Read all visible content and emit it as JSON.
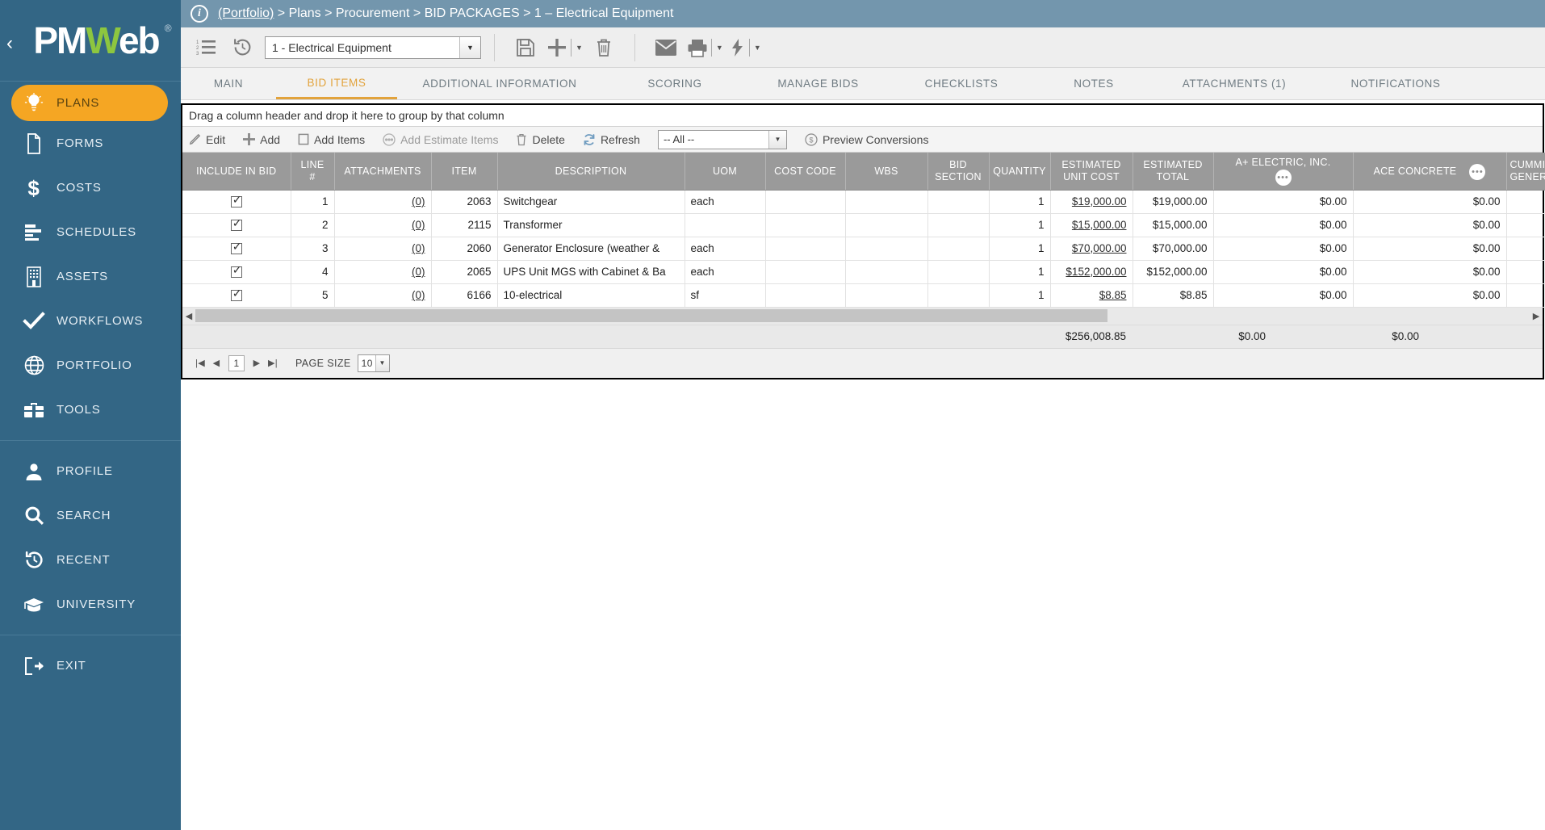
{
  "sidebar": {
    "logo": {
      "text_pm": "PM",
      "text_w": "W",
      "text_eb": "eb",
      "registered": "®",
      "collapse_icon": "‹"
    },
    "items": [
      {
        "label": "PLANS",
        "icon": "lightbulb-icon",
        "active": true
      },
      {
        "label": "FORMS",
        "icon": "document-icon",
        "active": false
      },
      {
        "label": "COSTS",
        "icon": "dollar-icon",
        "active": false
      },
      {
        "label": "SCHEDULES",
        "icon": "bars-icon",
        "active": false
      },
      {
        "label": "ASSETS",
        "icon": "building-icon",
        "active": false
      },
      {
        "label": "WORKFLOWS",
        "icon": "checkmark-icon",
        "active": false
      },
      {
        "label": "PORTFOLIO",
        "icon": "globe-icon",
        "active": false
      },
      {
        "label": "TOOLS",
        "icon": "toolbox-icon",
        "active": false
      }
    ],
    "items2": [
      {
        "label": "PROFILE",
        "icon": "person-icon"
      },
      {
        "label": "SEARCH",
        "icon": "search-icon"
      },
      {
        "label": "RECENT",
        "icon": "history-icon"
      },
      {
        "label": "UNIVERSITY",
        "icon": "graduation-cap-icon"
      }
    ],
    "items3": [
      {
        "label": "EXIT",
        "icon": "exit-icon"
      }
    ]
  },
  "breadcrumb": {
    "info_glyph": "i",
    "parts": [
      "(Portfolio)",
      "Plans",
      "Procurement",
      "BID PACKAGES",
      "1 – Electrical Equipment"
    ],
    "separator": ">"
  },
  "toolbar": {
    "list_icon": "numbered-list-icon",
    "history_icon": "history-icon",
    "record_select_value": "1 -  Electrical Equipment",
    "save_icon": "save-icon",
    "add_icon": "add-icon",
    "delete_icon": "trash-icon",
    "email_icon": "envelope-icon",
    "print_icon": "printer-icon",
    "actions_icon": "lightning-icon",
    "caret": "▼"
  },
  "tabs": [
    {
      "label": "MAIN",
      "active": false
    },
    {
      "label": "BID ITEMS",
      "active": true
    },
    {
      "label": "ADDITIONAL INFORMATION",
      "active": false
    },
    {
      "label": "SCORING",
      "active": false
    },
    {
      "label": "MANAGE BIDS",
      "active": false
    },
    {
      "label": "CHECKLISTS",
      "active": false
    },
    {
      "label": "NOTES",
      "active": false
    },
    {
      "label": "ATTACHMENTS (1)",
      "active": false
    },
    {
      "label": "NOTIFICATIONS",
      "active": false
    }
  ],
  "grid": {
    "group_hint": "Drag a column header and drop it here to group by that column",
    "toolbar": {
      "edit": "Edit",
      "add": "Add",
      "add_items": "Add Items",
      "add_estimate_items": "Add Estimate Items",
      "delete": "Delete",
      "refresh": "Refresh",
      "filter_value": "-- All --",
      "preview_conversions": "Preview Conversions",
      "preview_badge": "$"
    },
    "columns": [
      "INCLUDE IN BID",
      "LINE\n#",
      "ATTACHMENTS",
      "ITEM",
      "DESCRIPTION",
      "UOM",
      "COST CODE",
      "WBS",
      "BID\nSECTION",
      "QUANTITY",
      "ESTIMATED\nUNIT COST",
      "ESTIMATED\nTOTAL",
      "A+ ELECTRIC, INC.",
      "ACE CONCRETE",
      "CUMMINS\nGENERAT"
    ],
    "rows": [
      {
        "include": true,
        "line": "1",
        "attachments": "(0)",
        "item": "2063",
        "description": "Switchgear",
        "uom": "each",
        "cost_code": "",
        "wbs": "",
        "bid_section": "",
        "quantity": "1",
        "est_unit_cost": "$19,000.00",
        "est_total": "$19,000.00",
        "vendor1": "$0.00",
        "vendor2": "$0.00"
      },
      {
        "include": true,
        "line": "2",
        "attachments": "(0)",
        "item": "2115",
        "description": "Transformer",
        "uom": "",
        "cost_code": "",
        "wbs": "",
        "bid_section": "",
        "quantity": "1",
        "est_unit_cost": "$15,000.00",
        "est_total": "$15,000.00",
        "vendor1": "$0.00",
        "vendor2": "$0.00"
      },
      {
        "include": true,
        "line": "3",
        "attachments": "(0)",
        "item": "2060",
        "description": "Generator Enclosure (weather &",
        "uom": "each",
        "cost_code": "",
        "wbs": "",
        "bid_section": "",
        "quantity": "1",
        "est_unit_cost": "$70,000.00",
        "est_total": "$70,000.00",
        "vendor1": "$0.00",
        "vendor2": "$0.00"
      },
      {
        "include": true,
        "line": "4",
        "attachments": "(0)",
        "item": "2065",
        "description": "UPS Unit MGS with Cabinet & Ba",
        "uom": "each",
        "cost_code": "",
        "wbs": "",
        "bid_section": "",
        "quantity": "1",
        "est_unit_cost": "$152,000.00",
        "est_total": "$152,000.00",
        "vendor1": "$0.00",
        "vendor2": "$0.00"
      },
      {
        "include": true,
        "line": "5",
        "attachments": "(0)",
        "item": "6166",
        "description": "10-electrical",
        "uom": "sf",
        "cost_code": "",
        "wbs": "",
        "bid_section": "",
        "quantity": "1",
        "est_unit_cost": "$8.85",
        "est_total": "$8.85",
        "vendor1": "$0.00",
        "vendor2": "$0.00"
      }
    ],
    "totals": {
      "estimated_total": "$256,008.85",
      "vendor1_total": "$0.00",
      "vendor2_total": "$0.00"
    },
    "pager": {
      "first": "|◀",
      "prev": "◀",
      "next": "▶",
      "last": "▶|",
      "current_page": "1",
      "page_size_label": "PAGE SIZE",
      "page_size_value": "10"
    }
  },
  "colors": {
    "sidebar_bg": "#336685",
    "accent_orange": "#f5a623",
    "tab_active": "#e2a33c",
    "header_bar": "#7396ad",
    "grid_header": "#9a9a9a",
    "logo_green": "#8dc63f"
  }
}
